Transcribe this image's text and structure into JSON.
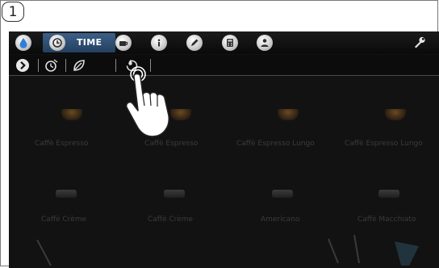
{
  "step_number": "1",
  "toolbar": {
    "time_label": "TIME"
  },
  "drinks": {
    "row1": [
      "Caffè Espresso",
      "Caffè Espresso",
      "Caffè Espresso Lungo",
      "Caffè Espresso Lungo"
    ],
    "row2": [
      "Caffè Crème",
      "Caffè Crème",
      "Americano",
      "Caffè Macchiato"
    ]
  },
  "colors": {
    "accent_tab": "#2f4f73",
    "drop_blue": "#2f7fd8",
    "screen_bg": "#121212"
  },
  "icons": [
    "water-drop-icon",
    "clock-icon",
    "cup-icon",
    "info-icon",
    "pencil-icon",
    "calculator-icon",
    "person-icon",
    "wrench-icon",
    "chevron-right-icon",
    "timer-icon",
    "leaf-icon",
    "water-hardness-icon",
    "pointing-hand-icon"
  ]
}
